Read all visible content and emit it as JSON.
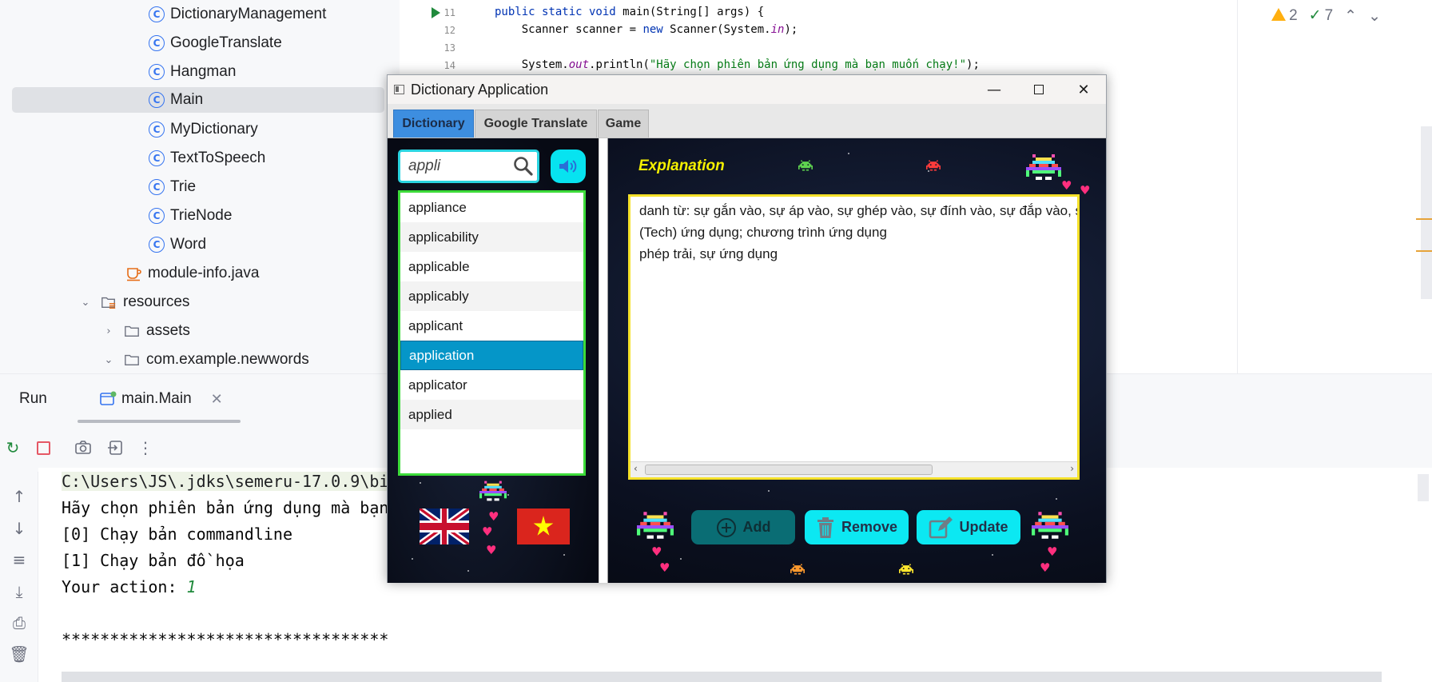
{
  "project_tree": {
    "items": [
      {
        "label": "DictionaryManagement",
        "kind": "class",
        "icon": "class-icon"
      },
      {
        "label": "GoogleTranslate",
        "kind": "class",
        "icon": "class-icon"
      },
      {
        "label": "Hangman",
        "kind": "class",
        "icon": "class-icon"
      },
      {
        "label": "Main",
        "kind": "class",
        "icon": "class-icon",
        "selected": true
      },
      {
        "label": "MyDictionary",
        "kind": "class",
        "icon": "class-icon"
      },
      {
        "label": "TextToSpeech",
        "kind": "class",
        "icon": "class-icon"
      },
      {
        "label": "Trie",
        "kind": "class",
        "icon": "class-icon"
      },
      {
        "label": "TrieNode",
        "kind": "class",
        "icon": "class-icon"
      },
      {
        "label": "Word",
        "kind": "class",
        "icon": "class-icon"
      },
      {
        "label": "module-info.java",
        "kind": "file",
        "icon": "java-file-icon"
      },
      {
        "label": "resources",
        "kind": "folder",
        "icon": "resources-folder-icon",
        "expanded": true
      },
      {
        "label": "assets",
        "kind": "folder",
        "icon": "folder-icon",
        "expanded": false
      },
      {
        "label": "com.example.newwords",
        "kind": "folder",
        "icon": "folder-icon",
        "expanded": true
      }
    ]
  },
  "editor": {
    "lines": [
      {
        "no": "11"
      },
      {
        "no": "12"
      },
      {
        "no": "13"
      },
      {
        "no": "14"
      }
    ],
    "code": {
      "l11_kw": "public static void",
      "l11_rest": " main(String[] args) {",
      "l12_a": "    Scanner scanner = ",
      "l12_kw": "new",
      "l12_b": " Scanner(System.",
      "l12_fld": "in",
      "l12_c": ");",
      "l14_a": "    System.",
      "l14_fld": "out",
      "l14_b": ".println(",
      "l14_str": "\"Hãy chọn phiên bản ứng dụng mà bạn muốn chạy!\"",
      "l14_c": ");"
    },
    "inspections": {
      "warnings": "2",
      "checks": "7"
    },
    "colors": {
      "warning": "#ffaf0f",
      "ok": "#208a3c"
    }
  },
  "run_window": {
    "title": "Run",
    "tab_label": "main.Main",
    "console": [
      "C:\\Users\\JS\\.jdks\\semeru-17.0.9\\bi",
      "Hãy chọn phiên bản ứng dụng mà bạn",
      "[0] Chạy bản commandline",
      "[1] Chạy bản đồ họa",
      "Your action: ",
      "",
      "**********************************"
    ],
    "user_input": "1"
  },
  "app": {
    "window_title": "Dictionary Application",
    "tabs": [
      {
        "label": "Dictionary",
        "active": true
      },
      {
        "label": "Google Translate",
        "active": false
      },
      {
        "label": "Game",
        "active": false
      }
    ],
    "search": {
      "value": "appli"
    },
    "words": [
      "appliance",
      "applicability",
      "applicable",
      "applicably",
      "applicant",
      "application",
      "applicator",
      "applied"
    ],
    "selected_word": "application",
    "explanation_title": "Explanation",
    "explanation": [
      "danh từ: sự gắn vào, sự áp vào, sự ghép vào, sự đính vào, sự đắp vào, s",
      "(Tech) ứng dụng; chương trình ứng dụng",
      "phép trải, sự ứng dụng"
    ],
    "buttons": {
      "add": "Add",
      "remove": "Remove",
      "update": "Update"
    },
    "flags": [
      "uk-flag",
      "vietnam-flag"
    ],
    "colors": {
      "accent": "#0ce8f2",
      "list_border": "#3ddc3a",
      "explain_border": "#f5e12a",
      "title_yellow": "#f5f000",
      "selected": "#0596c8"
    }
  }
}
